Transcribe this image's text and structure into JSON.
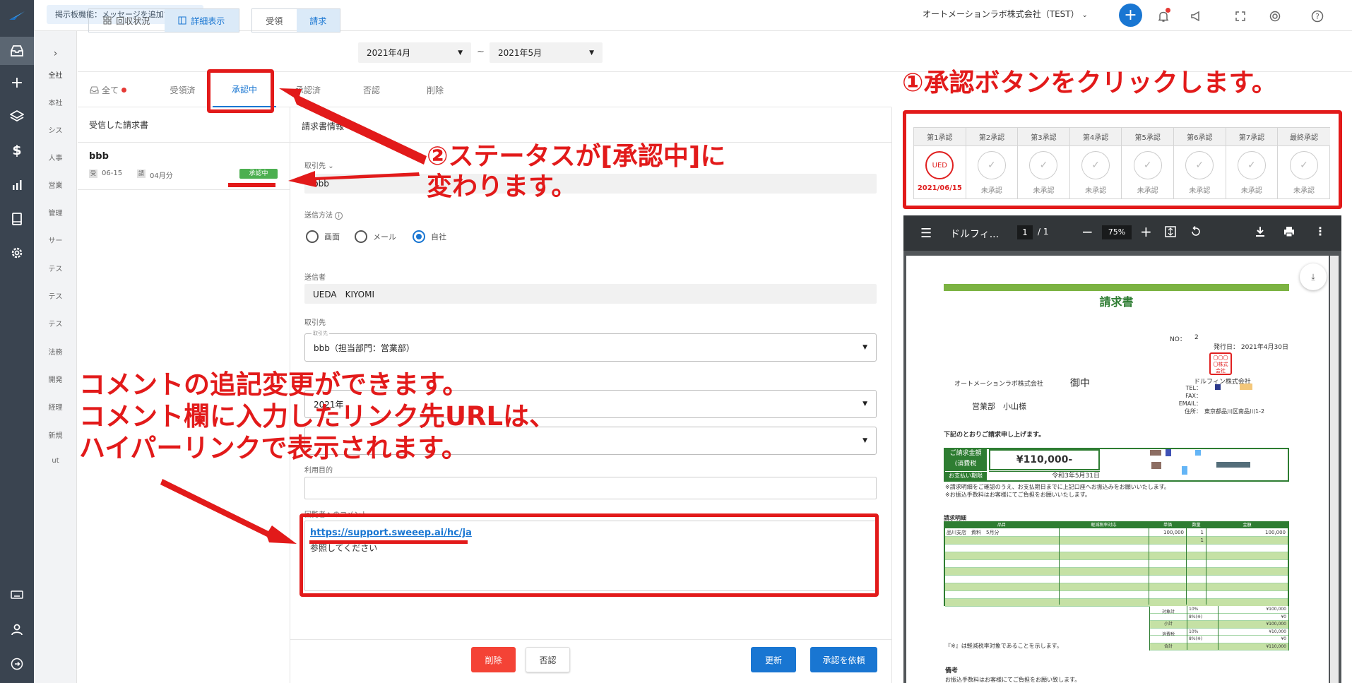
{
  "topbar": {
    "notice": "掲示板機能：メッセージを追加できます",
    "company": "オートメーションラボ株式会社（TEST）",
    "icons": [
      "plus-icon",
      "bell-icon",
      "megaphone-icon",
      "fullscreen-icon",
      "support-icon",
      "help-icon"
    ]
  },
  "sidebar": {
    "icons": [
      "inbox-icon",
      "plus-icon",
      "layers-icon",
      "dollar-icon",
      "chart-icon",
      "book-icon",
      "gear-icon",
      "keyboard-icon",
      "user-icon",
      "logout-icon"
    ]
  },
  "subnav": {
    "toggle": "›",
    "items": [
      "全社",
      "本社",
      "シス",
      "人事",
      "営業",
      "管理",
      "サー",
      "テス",
      "テス",
      "テス",
      "法務",
      "開発",
      "経理",
      "新規",
      "ut"
    ]
  },
  "filters": {
    "view_modes": [
      "回収状況",
      "詳細表示"
    ],
    "types": [
      "受領",
      "請求"
    ],
    "date_from": "2021年4月",
    "separator": "~",
    "date_to": "2021年5月"
  },
  "tabs": [
    "全て",
    "受領済",
    "承認中",
    "承認済",
    "否認",
    "削除"
  ],
  "list": {
    "header": "受信した請求書",
    "item": {
      "name": "bbb",
      "tag1": "受",
      "date": "06-15",
      "tag2": "請",
      "period": "04月分",
      "badge": "承認中"
    }
  },
  "form": {
    "header": "請求書情報",
    "partner_label": "取引先",
    "partner_value": "bbb",
    "send_method_label": "送信方法",
    "send_options": [
      "画面",
      "メール",
      "自社"
    ],
    "sender_label": "送信者",
    "sender_value": "UEDA　KIYOMI",
    "partner2_label": "取引先",
    "partner2_float": "取引先",
    "partner2_value": "bbb（担当部門：営業部）",
    "month_value": "2021年",
    "purpose_label": "利用目的",
    "comment_label": "回覧者へのコメント",
    "comment_link": "https://support.sweeep.ai/hc/ja",
    "comment_text": "参照してください"
  },
  "buttons": {
    "delete": "削除",
    "reject": "否認",
    "update": "更新",
    "request": "承認を依頼"
  },
  "approval": {
    "steps": [
      "第1承認",
      "第2承認",
      "第3承認",
      "第4承認",
      "第5承認",
      "第6承認",
      "第7承認",
      "最終承認"
    ],
    "first_stamp": "UED",
    "first_date": "2021/06/15",
    "pending": "未承認"
  },
  "pdf": {
    "title": "ドルフィ...",
    "page": "1",
    "total": "/ 1",
    "zoom": "75%",
    "doc_title": "請求書",
    "no_label": "NO：",
    "no_value": "2",
    "issue": "発行日： 2021年4月30日",
    "to_company": "オートメーションラボ株式会社",
    "onchu": "御中",
    "to_person": "営業部　小山様",
    "seal": "〇〇〇 〇株式 会社",
    "from_company": "ドルフィン株式会社",
    "tel": "TEL：",
    "fax": "FAX：",
    "email": "EMAIL：",
    "addr_label": "住所：",
    "address": "東京都品川区南品川1-2",
    "intro": "下記のとおりご請求申し上げます。",
    "amount_label": "ご請求金額",
    "tax_label": "(消費税",
    "amount": "¥110,000-",
    "due_label": "お支払い期限",
    "due": "令和3年5月31日",
    "note1": "※請求明細をご確認のうえ、お支払期日までに上記口座へお振込みをお願いいたします。",
    "note2": "※お振込手数料はお客様にてご負担をお願いいたします。",
    "detail_title": "請求明細",
    "cols": [
      "品目",
      "軽減税率対応",
      "単価",
      "数量",
      "金額"
    ],
    "row1": [
      "品川支店　資料　5月分",
      "",
      "100,000",
      "1",
      "100,000"
    ],
    "row2_qty": "1",
    "sum_labels": [
      "対象計",
      "小計",
      "消費税",
      "合計"
    ],
    "sum_rates": [
      "10%",
      "8%(※)",
      "",
      "10%",
      "8%(※)",
      ""
    ],
    "sum_values": [
      "¥100,000",
      "¥0",
      "¥100,000",
      "¥10,000",
      "¥0",
      "¥110,000"
    ],
    "footnote": "『※』は軽減税率対象であることを示します。",
    "remarks": "備考",
    "remarks_text": "お振込手数料はお客様にてご負担をお願い致します。"
  },
  "annotations": {
    "a1": "①承認ボタンをクリックします。",
    "a2_line1": "②ステータスが[承認中]に",
    "a2_line2": "変わります。",
    "a3_line1": "コメントの追記変更ができます。",
    "a3_line2": "コメント欄に入力したリンク先URLは、",
    "a3_line3": "ハイパーリンクで表示されます。"
  },
  "colors": {
    "primary": "#1976d2",
    "annotation": "#e21a1a",
    "sidebar": "#3a4450",
    "badge": "#4caf50",
    "danger": "#f44336",
    "invoice_green": "#2e7d32"
  }
}
